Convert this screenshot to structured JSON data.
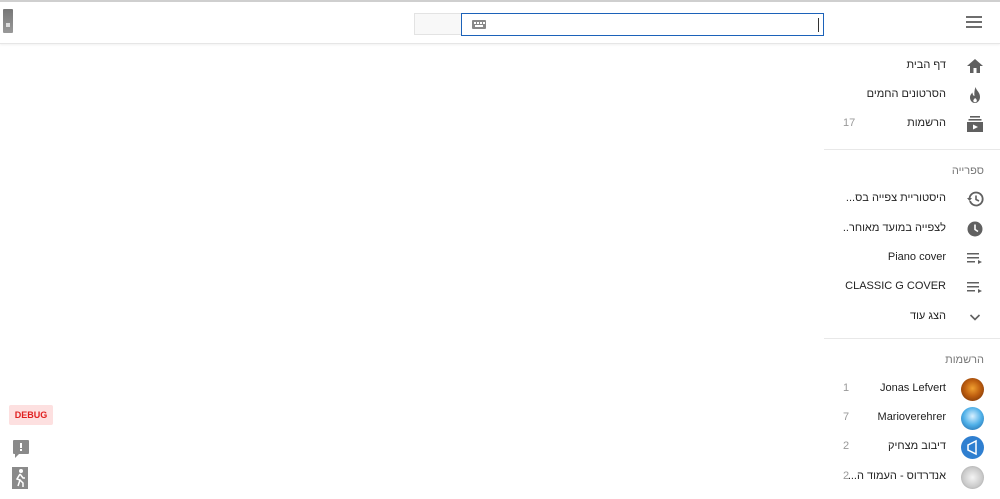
{
  "topbar": {
    "search": {
      "value": "",
      "placeholder": ""
    }
  },
  "sidebar": {
    "main_items": [
      {
        "label": "דף הבית",
        "icon": "home-icon"
      },
      {
        "label": "הסרטונים החמים",
        "icon": "flame-icon"
      },
      {
        "label": "הרשמות",
        "icon": "subscriptions-icon",
        "count": "17"
      }
    ],
    "library_title": "ספרייה",
    "library_items": [
      {
        "label": "היסטוריית צפייה בס...",
        "icon": "history-icon"
      },
      {
        "label": "לצפייה במועד מאוחר..",
        "icon": "clock-icon"
      },
      {
        "label": "Piano cover",
        "icon": "playlist-icon"
      },
      {
        "label": "CLASSIC G COVER",
        "icon": "playlist-icon"
      },
      {
        "label": "הצג עוד",
        "icon": "chevron-down-icon"
      }
    ],
    "subscriptions_title": "הרשמות",
    "subscriptions": [
      {
        "label": "Jonas Lefvert",
        "count": "1"
      },
      {
        "label": "Marioverehrer",
        "count": "7"
      },
      {
        "label": "דיבוב מצחיק",
        "count": "2"
      },
      {
        "label": "אנדרדוס - העמוד ה...",
        "count": "2"
      }
    ]
  },
  "debug": {
    "label": "DEBUG"
  },
  "colors": {
    "accent": "#1c62b9",
    "debug": "#e02020"
  }
}
